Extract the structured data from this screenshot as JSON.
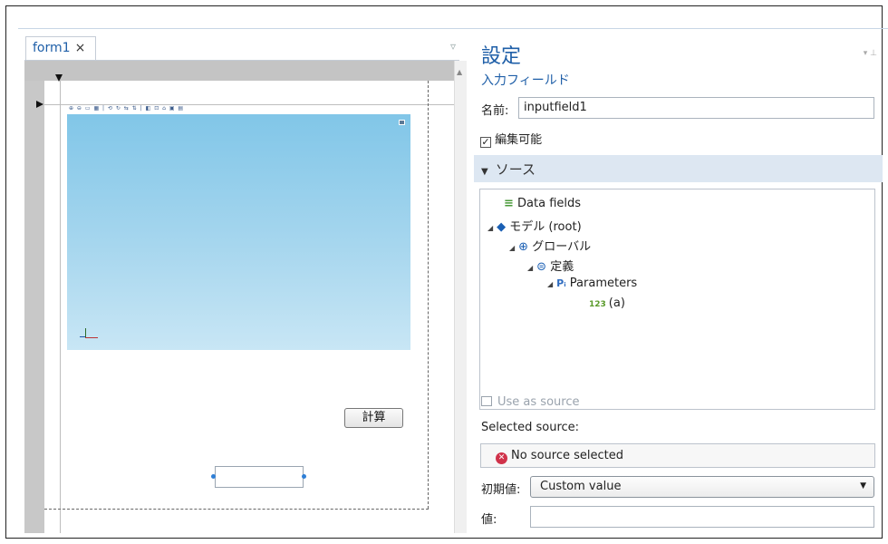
{
  "editor": {
    "tab_label": "form1",
    "tab_close": "×",
    "calc_button_label": "計算",
    "graphics_toolbar_glyphs": "⊕ ⊖ ▭ ▦ | ⟲ ↻ ⇆ ⇅ | ◧ ⊡ ⌂ ▣ ▤"
  },
  "settings": {
    "title": "設定",
    "subtitle": "入力フィールド",
    "name_label": "名前:",
    "name_value": "inputfield1",
    "editable_label": "編集可能",
    "editable_checked": true,
    "source_section_label": "ソース",
    "tree": [
      {
        "label": "Data fields",
        "icon": "data-fields-icon"
      },
      {
        "label": "モデル (root)",
        "icon": "model-icon"
      },
      {
        "label": "グローバル",
        "icon": "globe-icon"
      },
      {
        "label": "定義",
        "icon": "definitions-icon"
      },
      {
        "label": "Parameters",
        "icon": "parameters-icon",
        "icon_text": "Pᵢ"
      },
      {
        "label": "(a)",
        "icon": "number-icon",
        "icon_text": "123"
      }
    ],
    "use_as_source_label": "Use as source",
    "selected_source_label": "Selected source:",
    "no_source_text": "No source selected",
    "initial_value_label": "初期値:",
    "initial_value_selected": "Custom value",
    "value_label": "値:",
    "value_value": ""
  },
  "colors": {
    "accent": "#1f5fa8",
    "section_bar": "#dde7f2",
    "error": "#d0324a"
  }
}
